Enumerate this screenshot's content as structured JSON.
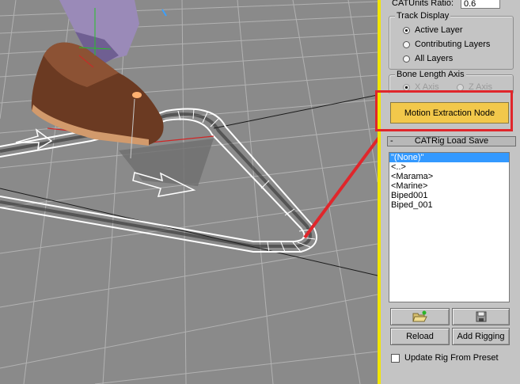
{
  "panel": {
    "cat_units_label": "CATUnits Ratio:",
    "cat_units_value": "0.6",
    "track_display": {
      "title": "Track Display",
      "options": [
        "Active Layer",
        "Contributing Layers",
        "All Layers"
      ],
      "selected": "Active Layer"
    },
    "bone_length_axis": {
      "title": "Bone Length Axis",
      "options": [
        "X Axis",
        "Z Axis"
      ],
      "selected": "X Axis",
      "disabled": true
    },
    "motion_extraction_button": "Motion Extraction Node",
    "catrig_load_save": {
      "collapse_symbol": "-",
      "title": "CATRig Load Save",
      "items": [
        "\"(None)\"",
        "<..>",
        "<Marama>",
        "<Marine>",
        "Biped001",
        "Biped_001"
      ],
      "selected_index": 0
    },
    "buttons": {
      "open_icon": "folder-open-icon",
      "save_icon": "save-disk-icon",
      "reload": "Reload",
      "add_rigging": "Add Rigging"
    },
    "update_rig_checkbox": {
      "label": "Update Rig From Preset",
      "checked": false
    }
  },
  "colors": {
    "viewport_bg": "#8a8a8a",
    "panel_bg": "#c4c4c4",
    "highlight": "#e0262b",
    "active_border": "#f2e600",
    "button_accent": "#f2c84b",
    "selection": "#3399ff"
  }
}
